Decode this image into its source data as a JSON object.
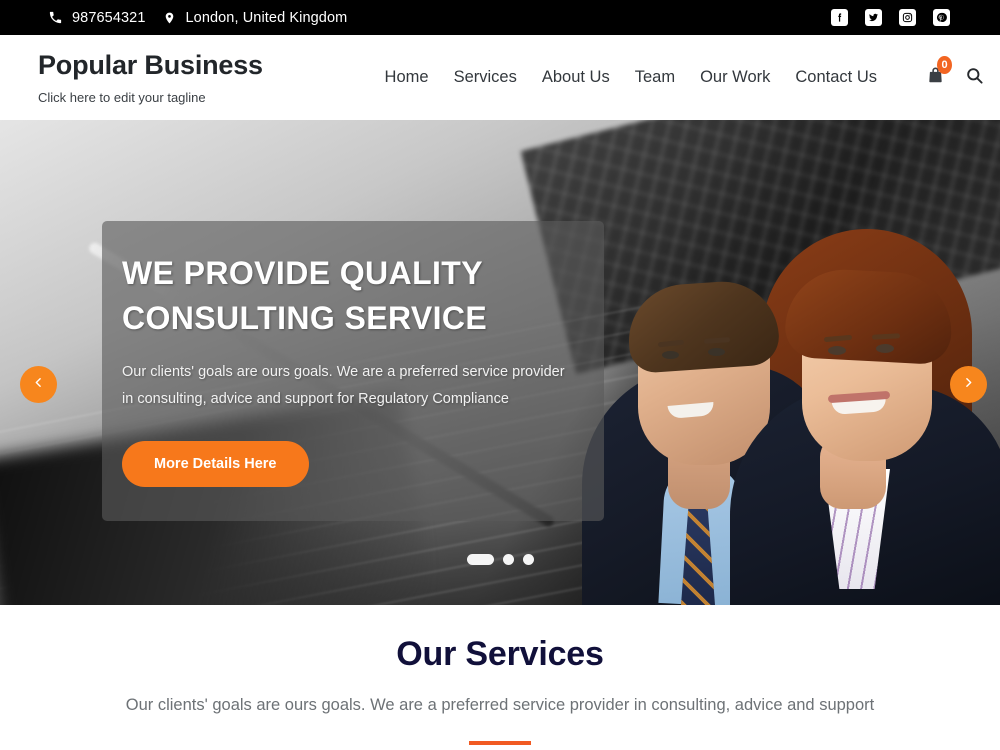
{
  "topbar": {
    "phone": "987654321",
    "phone_icon": "phone-icon",
    "location": "London, United Kingdom",
    "location_icon": "map-pin-icon",
    "socials": [
      {
        "name": "facebook-icon",
        "label": "Facebook"
      },
      {
        "name": "twitter-icon",
        "label": "Twitter"
      },
      {
        "name": "instagram-icon",
        "label": "Instagram"
      },
      {
        "name": "pinterest-icon",
        "label": "Pinterest"
      }
    ]
  },
  "header": {
    "brand_title": "Popular Business",
    "brand_tagline": "Click here to edit your tagline",
    "nav": [
      {
        "label": "Home"
      },
      {
        "label": "Services"
      },
      {
        "label": "About Us"
      },
      {
        "label": "Team"
      },
      {
        "label": "Our Work"
      },
      {
        "label": "Contact Us"
      }
    ],
    "cart_icon": "shopping-bag-icon",
    "cart_count": "0",
    "search_icon": "search-icon"
  },
  "hero": {
    "title_line1": "WE PROVIDE QUALITY",
    "title_line2": "CONSULTING SERVICE",
    "description": "Our clients' goals are ours goals. We are a preferred service provider in consulting, advice and support for Regulatory Compliance",
    "button_label": "More Details Here",
    "prev_icon": "chevron-left-icon",
    "next_icon": "chevron-right-icon",
    "slide_count": 3,
    "active_slide": 1
  },
  "services": {
    "title": "Our Services",
    "subtitle": "Our clients' goals are ours goals. We are a preferred service provider in consulting, advice and support"
  },
  "colors": {
    "accent_orange": "#f7781b",
    "divider_orange": "#f15a22",
    "topbar_black": "#000000",
    "heading_navy": "#11103a",
    "nav_text": "#33383d"
  }
}
